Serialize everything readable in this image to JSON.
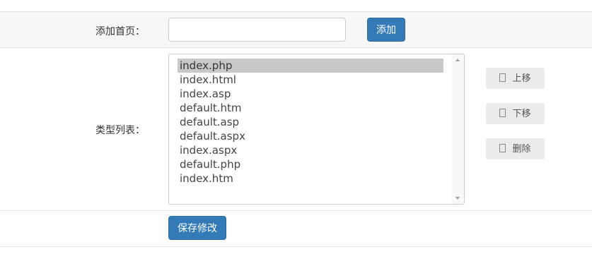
{
  "add_homepage": {
    "label": "添加首页：",
    "input_value": "",
    "input_placeholder": "",
    "add_button": "添加"
  },
  "type_list": {
    "label": "类型列表：",
    "items": [
      "index.php",
      "index.html",
      "index.asp",
      "default.htm",
      "default.asp",
      "default.aspx",
      "index.aspx",
      "default.php",
      "index.htm"
    ],
    "selected_index": 0
  },
  "side_buttons": {
    "move_up": "上移",
    "move_down": "下移",
    "delete": "删除"
  },
  "save_button": "保存修改",
  "colors": {
    "primary": "#337ab7",
    "selected_item": "#c8c8c8",
    "row_alt": "#f7f7f7"
  }
}
